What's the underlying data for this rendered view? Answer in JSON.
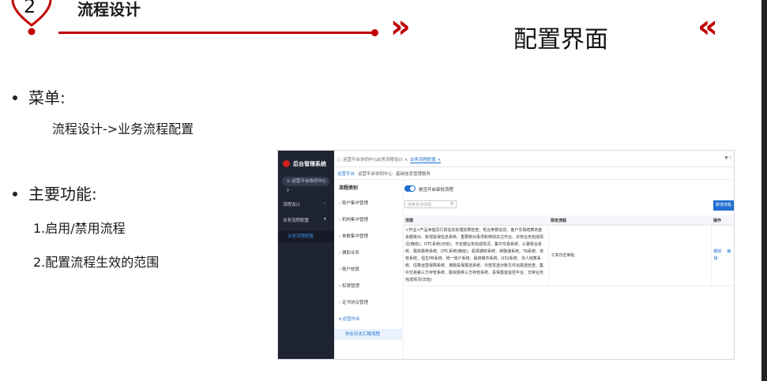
{
  "header": {
    "section_number": "2",
    "section_title": "流程设计",
    "arrow_right": "»",
    "arrow_left": "«",
    "page_title": "配置界面",
    "accent_color": "#c00000"
  },
  "content": {
    "menu_label": "菜单:",
    "menu_path": "流程设计->业务流程配置",
    "features_label": "主要功能:",
    "features": [
      "1.启用/禁用流程",
      "2.配置流程生效的范围"
    ]
  },
  "app": {
    "logo_text": "后台管理系统",
    "side_switch": "运营平台协同中心",
    "side_items": [
      "流程设计",
      "业务流程配置"
    ],
    "side_sub_item": "业务流程配置",
    "tabs": [
      "运营平台协同中心",
      "业务流程设计",
      "业务流程配置"
    ],
    "tab_close": "×",
    "more_icon": "▼ !",
    "breadcrumbs": [
      "运营平台",
      "运营平台协同中心",
      "基础信息管理服务"
    ],
    "tree_title": "流程类别",
    "tree_items": [
      "账户集中管理",
      "机构集中管理",
      "参数集中管理",
      "辅助业务",
      "账户核算",
      "权限管理",
      "证书协议管理",
      "运营作业"
    ],
    "tree_selected": "作业日志汇报流程",
    "toggle_label": "是否开启审批流程",
    "search_placeholder": "搜索查询流程",
    "add_button": "新增流程",
    "table": {
      "headers": [
        "范围",
        "规定流程",
        "操作"
      ],
      "row": {
        "scope": "<作业>产品净值及行情信息处理结果检查、柜台参数信息、客户交易结算资金余额核对、新增投保信息系统、重要核对事项和特别关注作业、日常业务完成情况(晚班)、OTC系统(日班)、不定期业务完成情况、集中交易系统、公募柜台系统、融资融券系统、OTC系统(晚班)、股票期权系统、转融通系统、TA系统、资管系统、恒生PB系统、统一账户系统、股转做市系统、O32系统、法人结算系统、估算运营保障系统、港融投保报送系统、外部发送对账文件出报送检查、集中交易第三方存管系统、融资融券三方存管系统、投保基金监控平台、日常业务完成情况(日班)",
        "flow": "工单日志审批",
        "actions": [
          "删除",
          "编辑"
        ]
      }
    }
  }
}
